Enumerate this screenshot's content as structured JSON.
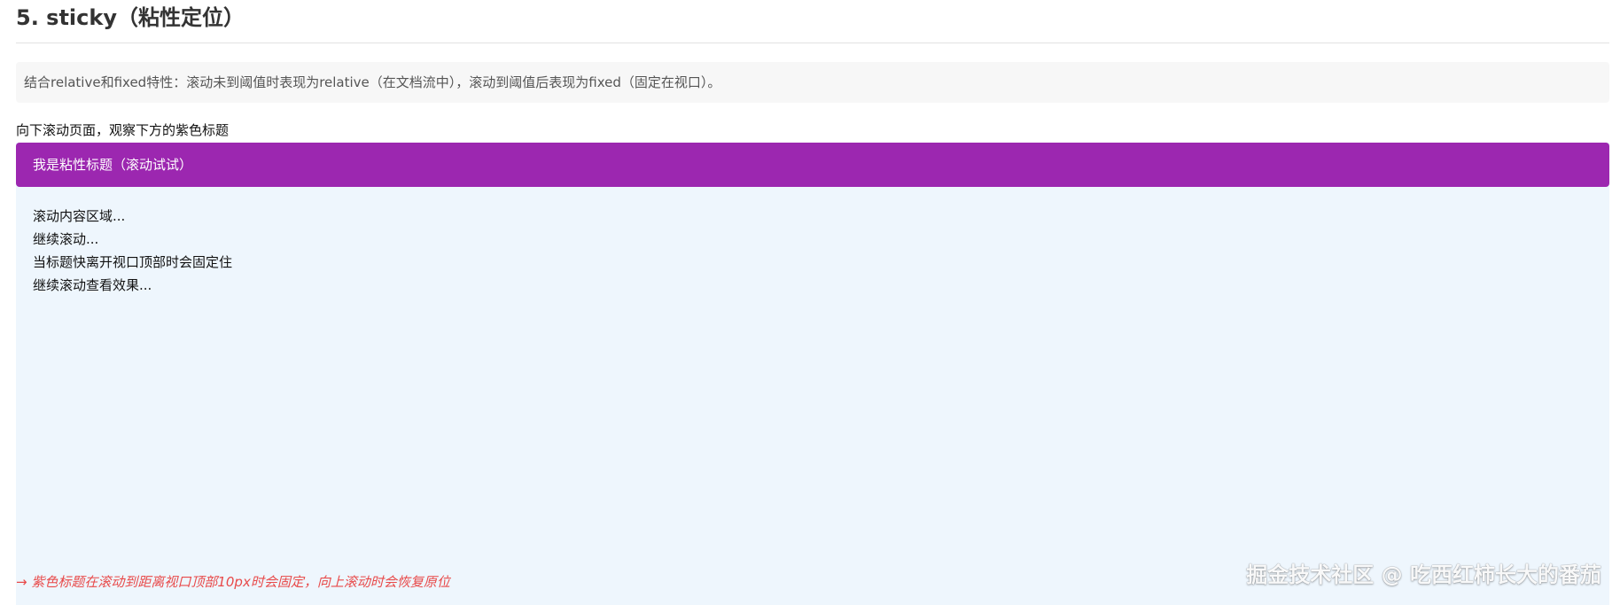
{
  "section": {
    "title": "5. sticky（粘性定位）"
  },
  "description": {
    "text": "结合relative和fixed特性：滚动未到阈值时表现为relative（在文档流中），滚动到阈值后表现为fixed（固定在视口）。"
  },
  "scroll_hint": {
    "text": "向下滚动页面，观察下方的紫色标题"
  },
  "demo": {
    "sticky_header": "我是粘性标题（滚动试试）",
    "content_lines": [
      "滚动内容区域...",
      "继续滚动...",
      "当标题快离开视口顶部时会固定住",
      "继续滚动查看效果..."
    ]
  },
  "note": {
    "text": "→ 紫色标题在滚动到距离视口顶部10px时会固定，向上滚动时会恢复原位"
  },
  "watermark": {
    "text": "掘金技术社区 @ 吃西红柿长大的番茄"
  },
  "colors": {
    "sticky_header_background": "#9c27b0",
    "scroll_area_background": "#eef6fd",
    "note_text": "#e84a4a"
  }
}
